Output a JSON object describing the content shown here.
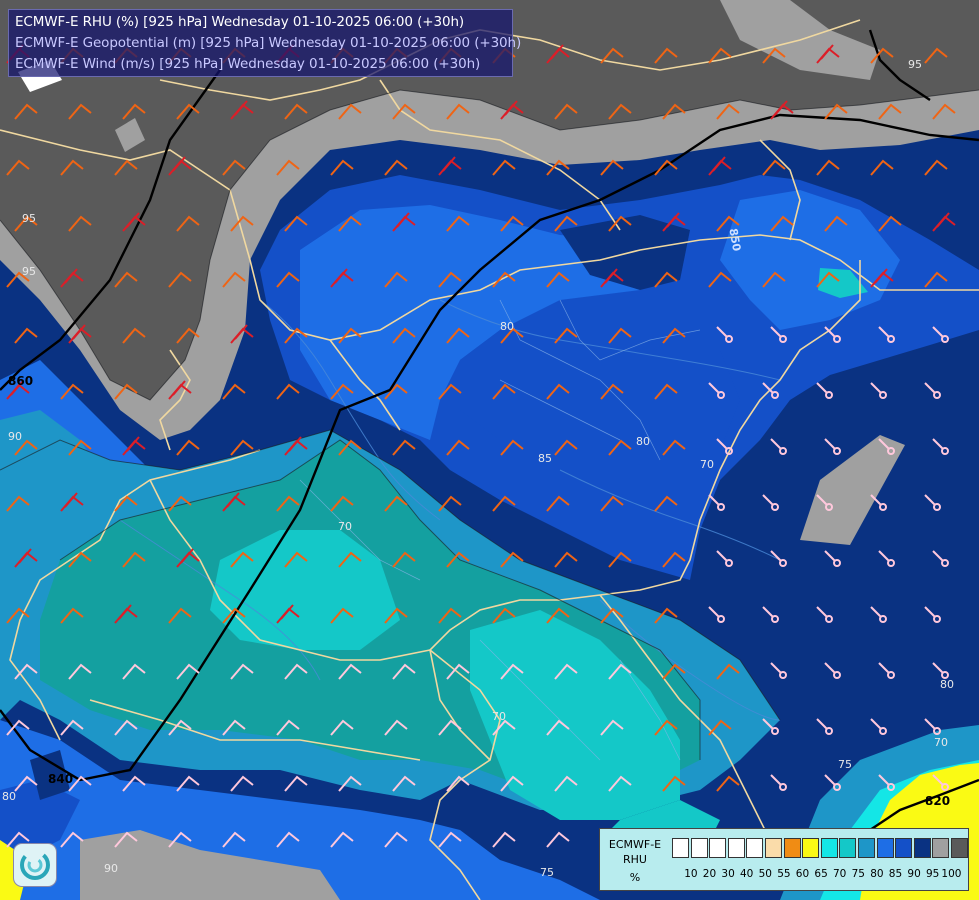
{
  "title": {
    "line1": "ECMWF-E RHU (%) [925 hPa] Wednesday 01-10-2025 06:00 (+30h)",
    "line2": "ECMWF-E Geopotential (m) [925 hPa] Wednesday 01-10-2025 06:00 (+30h)",
    "line3": "ECMWF-E Wind (m/s) [925 hPa] Wednesday 01-10-2025 06:00 (+30h)",
    "colors": {
      "line1": "#ffffff",
      "line2": "#c8c8ff",
      "line3": "#c8c8ff"
    }
  },
  "legend": {
    "name_line1": "ECMWF-E",
    "name_line2": "RHU",
    "unit": "%",
    "classes": [
      {
        "color": "#ffffff"
      },
      {
        "color": "#ffffff"
      },
      {
        "color": "#ffffff"
      },
      {
        "color": "#ffffff"
      },
      {
        "color": "#ffffff"
      },
      {
        "color": "#fadcaa"
      },
      {
        "color": "#f08c14"
      },
      {
        "color": "#fafa14"
      },
      {
        "color": "#14e6e6"
      },
      {
        "color": "#14c8c8"
      },
      {
        "color": "#1e96c8"
      },
      {
        "color": "#1e6ee6"
      },
      {
        "color": "#1450c8"
      },
      {
        "color": "#0a3282"
      },
      {
        "color": "#a0a0a0"
      },
      {
        "color": "#5a5a5a"
      }
    ],
    "ticks": [
      "10",
      "20",
      "30",
      "40",
      "50",
      "55",
      "60",
      "65",
      "70",
      "75",
      "80",
      "85",
      "90",
      "95",
      "100"
    ]
  },
  "contour_labels": {
    "geopotential": [
      "860",
      "840",
      "820",
      "850"
    ],
    "rhu": [
      "95",
      "95",
      "95",
      "90",
      "85",
      "80",
      "80",
      "80",
      "80",
      "75",
      "75",
      "70",
      "70",
      "70",
      "70",
      "90"
    ]
  },
  "map_colors": {
    "rhu_100": "#5a5a5a",
    "rhu_95": "#a0a0a0",
    "rhu_90": "#0a3282",
    "rhu_85": "#1450c8",
    "rhu_80": "#1e6ee6",
    "rhu_75": "#1e96c8",
    "rhu_70": "#14a0a0",
    "rhu_65": "#14c8c8",
    "rhu_60": "#14e6e6",
    "rhu_55": "#fafa14",
    "borders": "#f0d8a0",
    "geopotential_line": "#000000",
    "wind_orange": "#f06414",
    "wind_red": "#dc1e28",
    "wind_pink": "#ffc8dc"
  },
  "icons": {
    "logo": "meteo-swirl-icon"
  }
}
